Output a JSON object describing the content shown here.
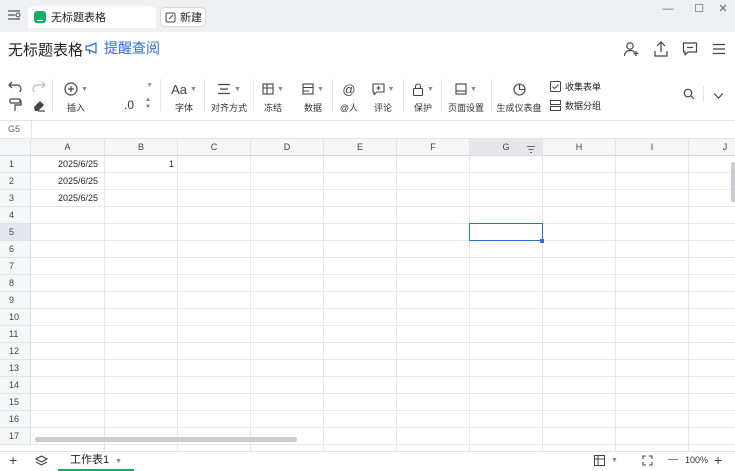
{
  "window": {
    "active_tab": "无标题表格",
    "new_tab": "新建",
    "minimize": "—",
    "maximize": "☐",
    "close": "✕"
  },
  "header": {
    "title": "无标题表格",
    "remind_label": "提醒查阅"
  },
  "toolbar": {
    "insert": "插入",
    "decimal": ".0",
    "font": "字体",
    "font_glyph": "Aa",
    "align": "对齐方式",
    "freeze": "冻结",
    "data": "数据",
    "mention": "@人",
    "mention_glyph": "@",
    "comment": "评论",
    "protect": "保护",
    "page_setup": "页面设置",
    "dashboard": "生成仪表盘",
    "collect_form": "收集表单",
    "data_group": "数据分组"
  },
  "formula_bar": {
    "cell_ref": "G5"
  },
  "grid": {
    "columns": [
      "A",
      "B",
      "C",
      "D",
      "E",
      "F",
      "G",
      "H",
      "I",
      "J"
    ],
    "rows": [
      "1",
      "2",
      "3",
      "4",
      "5",
      "6",
      "7",
      "8",
      "9",
      "10",
      "11",
      "12",
      "13",
      "14",
      "15",
      "16",
      "17"
    ],
    "selected_cell": "G5",
    "cells": {
      "A1": "2025/6/25",
      "A2": "2025/6/25",
      "A3": "2025/6/25",
      "B1": "1"
    }
  },
  "bottom": {
    "sheet_name": "工作表1",
    "zoom": "100%",
    "add": "+",
    "zoom_minus": "—",
    "zoom_plus": "+"
  },
  "colors": {
    "accent": "#2e6fd8",
    "brand": "#1aad64",
    "header_bg": "#f5f6f7",
    "selected_header_bg": "#e4e7eb"
  }
}
